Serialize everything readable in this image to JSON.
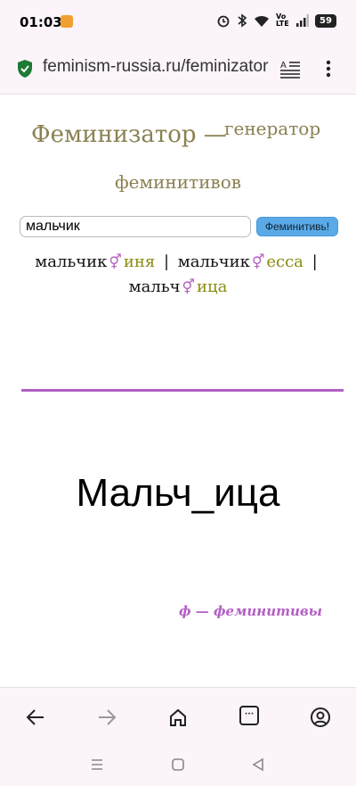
{
  "status_bar": {
    "time": "01:03",
    "network_label": "Vo LTE",
    "battery": "59"
  },
  "browser": {
    "url": "feminism-russia.ru/feminizator"
  },
  "page": {
    "title_main": "Феминизатор —",
    "title_sub_line1": "генератор",
    "title_sub_line2": "феминитивов",
    "input_value": "мальчик",
    "button_label": "Феминитивь!",
    "results": [
      {
        "stem": "мальчик",
        "symbol": "⚥",
        "suffix": "иня"
      },
      {
        "stem": "мальчик",
        "symbol": "⚥",
        "suffix": "есса"
      },
      {
        "stem": "мальч",
        "symbol": "⚥",
        "suffix": "ица"
      }
    ],
    "separator": "|",
    "big_word": "Мальч_ица",
    "footer_link": "ф — феминитивы"
  },
  "colors": {
    "title": "#8a8152",
    "suffix": "#8a8c10",
    "accent": "#b35fc3",
    "button": "#5aaae8"
  },
  "icons": {
    "status": [
      "alarm-icon",
      "bluetooth-icon",
      "wifi-icon",
      "signal-icon",
      "battery-icon"
    ],
    "url_bar": [
      "shield-check-icon",
      "reader-mode-icon",
      "more-vertical-icon"
    ],
    "nav": [
      "back-arrow-icon",
      "forward-arrow-icon",
      "home-icon",
      "tabs-icon",
      "profile-icon"
    ],
    "system": [
      "recents-icon",
      "home-circle-icon",
      "back-triangle-icon"
    ]
  }
}
